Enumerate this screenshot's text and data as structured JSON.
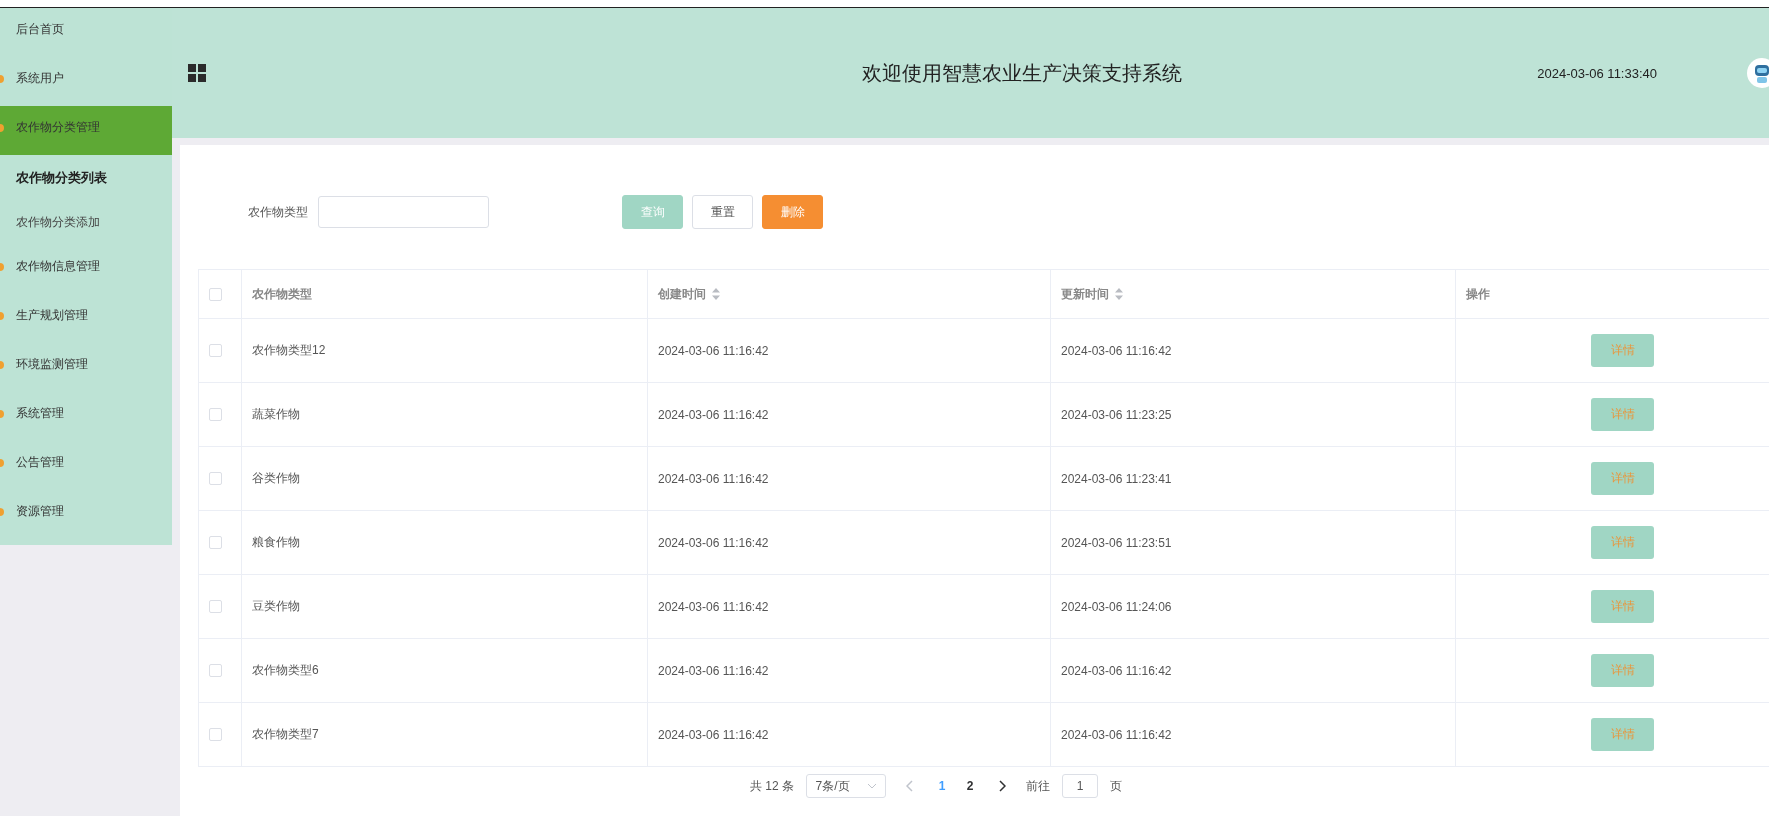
{
  "sidebar": {
    "items": [
      {
        "label": "后台首页",
        "kind": "home",
        "selected": false
      },
      {
        "label": "系统用户",
        "kind": "group",
        "selected": false
      },
      {
        "label": "农作物分类管理",
        "kind": "group",
        "selected": true,
        "children": [
          {
            "label": "农作物分类列表",
            "selected": true
          },
          {
            "label": "农作物分类添加",
            "selected": false
          }
        ]
      },
      {
        "label": "农作物信息管理",
        "kind": "group",
        "selected": false
      },
      {
        "label": "生产规划管理",
        "kind": "group",
        "selected": false
      },
      {
        "label": "环境监测管理",
        "kind": "group",
        "selected": false
      },
      {
        "label": "系统管理",
        "kind": "group",
        "selected": false
      },
      {
        "label": "公告管理",
        "kind": "group",
        "selected": false
      },
      {
        "label": "资源管理",
        "kind": "group",
        "selected": false
      }
    ]
  },
  "header": {
    "title": "欢迎使用智慧农业生产决策支持系统",
    "datetime": "2024-03-06 11:33:40"
  },
  "filter": {
    "label": "农作物类型",
    "buttons": [
      {
        "label": "查询",
        "kind": "primary"
      },
      {
        "label": "重置",
        "kind": "plain"
      },
      {
        "label": "删除",
        "kind": "danger"
      }
    ]
  },
  "table": {
    "all_checked": false,
    "columns": [
      {
        "label": "农作物类型",
        "sortable": false
      },
      {
        "label": "创建时间",
        "sortable": true
      },
      {
        "label": "更新时间",
        "sortable": true
      },
      {
        "label": "操作",
        "sortable": false
      }
    ],
    "rows": [
      {
        "checked": false,
        "cells": [
          "农作物类型12",
          "2024-03-06 11:16:42",
          "2024-03-06 11:16:42"
        ],
        "action": "详情"
      },
      {
        "checked": false,
        "cells": [
          "蔬菜作物",
          "2024-03-06 11:16:42",
          "2024-03-06 11:23:25"
        ],
        "action": "详情"
      },
      {
        "checked": false,
        "cells": [
          "谷类作物",
          "2024-03-06 11:16:42",
          "2024-03-06 11:23:41"
        ],
        "action": "详情"
      },
      {
        "checked": false,
        "cells": [
          "粮食作物",
          "2024-03-06 11:16:42",
          "2024-03-06 11:23:51"
        ],
        "action": "详情"
      },
      {
        "checked": false,
        "cells": [
          "豆类作物",
          "2024-03-06 11:16:42",
          "2024-03-06 11:24:06"
        ],
        "action": "详情"
      },
      {
        "checked": false,
        "cells": [
          "农作物类型6",
          "2024-03-06 11:16:42",
          "2024-03-06 11:16:42"
        ],
        "action": "详情"
      },
      {
        "checked": false,
        "cells": [
          "农作物类型7",
          "2024-03-06 11:16:42",
          "2024-03-06 11:16:42"
        ],
        "action": "详情"
      }
    ]
  },
  "pagination": {
    "total": "共 12 条",
    "page_size": "7条/页",
    "pages": [
      {
        "label": "1",
        "selected": true
      },
      {
        "label": "2",
        "selected": false
      }
    ],
    "goto_label": "前往",
    "goto_value": "1",
    "goto_suffix": "页"
  }
}
